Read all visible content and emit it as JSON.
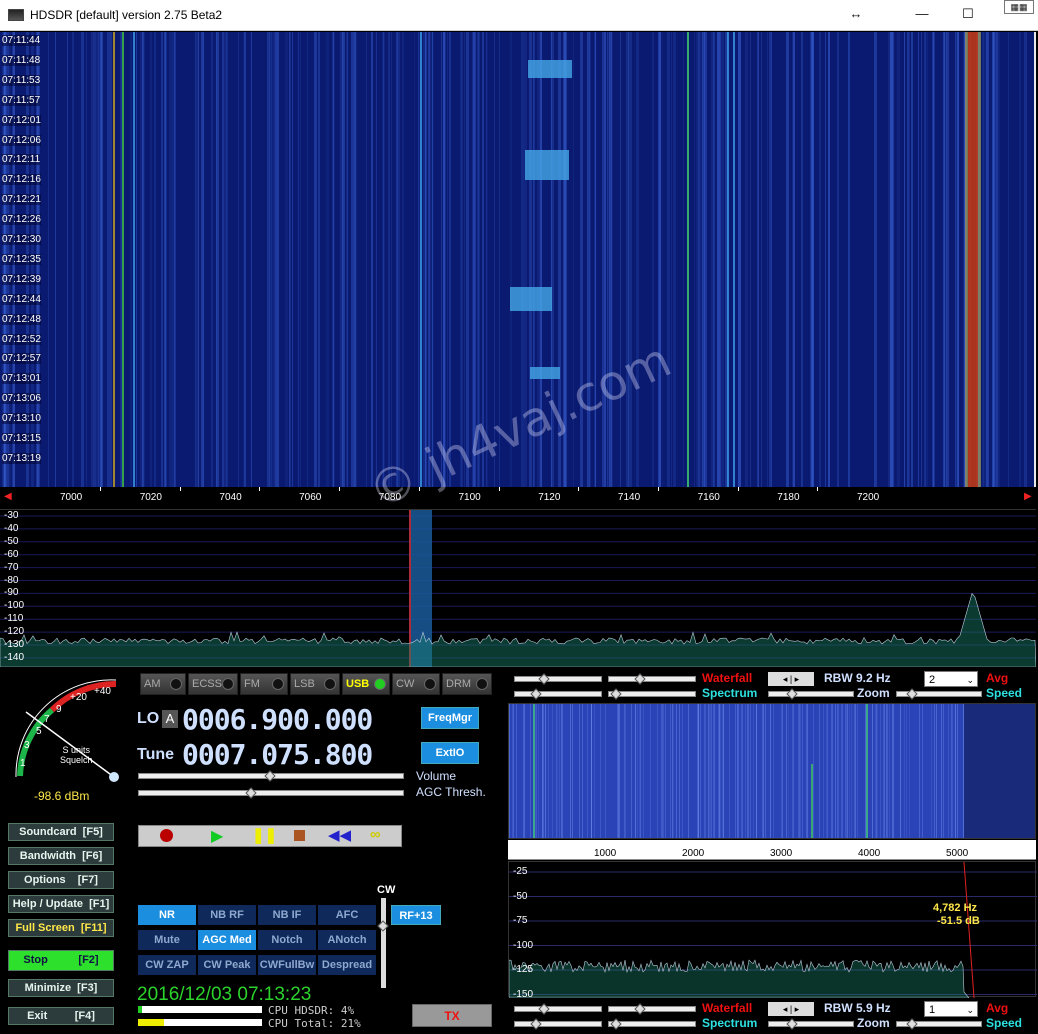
{
  "window": {
    "title": "HDSDR  [default]  version 2.75 Beta2"
  },
  "waterfall": {
    "times": [
      "07:11:44",
      "07:11:48",
      "07:11:53",
      "07:11:57",
      "07:12:01",
      "07:12:06",
      "07:12:11",
      "07:12:16",
      "07:12:21",
      "07:12:26",
      "07:12:30",
      "07:12:35",
      "07:12:39",
      "07:12:44",
      "07:12:48",
      "07:12:52",
      "07:12:57",
      "07:13:01",
      "07:13:06",
      "07:13:10",
      "07:13:15",
      "07:13:19"
    ],
    "freqs": [
      "7000",
      "7020",
      "7040",
      "7060",
      "7080",
      "7100",
      "7120",
      "7140",
      "7160",
      "7180",
      "7200"
    ]
  },
  "spectrum": {
    "db_labels": [
      "-30",
      "-40",
      "-50",
      "-60",
      "-70",
      "-80",
      "-90",
      "-100",
      "-110",
      "-120",
      "-130",
      "-140"
    ]
  },
  "watermark": "© jh4vaj.com",
  "smeter": {
    "scale": [
      "1",
      "3",
      "5",
      "7",
      "9",
      "+20",
      "+40"
    ],
    "squelch": "S units\nSquelch",
    "level": "-98.6 dBm"
  },
  "modes": [
    "AM",
    "ECSS",
    "FM",
    "LSB",
    "USB",
    "CW",
    "DRM"
  ],
  "active_mode": "USB",
  "lo": {
    "label": "LO",
    "badge": "A",
    "value": "0006.900.000"
  },
  "tune": {
    "label": "Tune",
    "value": "0007.075.800"
  },
  "freqmgr": "FreqMgr",
  "extio": "ExtIO",
  "volume": "Volume",
  "agc_thresh": "AGC Thresh.",
  "side_buttons": [
    "Soundcard  [F5]",
    "Bandwidth  [F6]",
    "Options    [F7]",
    "Help / Update  [F1]",
    "Full Screen  [F11]",
    "Stop          [F2]",
    "Minimize  [F3]",
    "Exit         [F4]"
  ],
  "dsp_row1": [
    "NR",
    "NB RF",
    "NB IF",
    "AFC"
  ],
  "dsp_row2": [
    "Mute",
    "AGC Med",
    "Notch",
    "ANotch"
  ],
  "dsp_row3": [
    "CW ZAP",
    "CW Peak",
    "CWFullBw",
    "Despread"
  ],
  "rf": "RF+13",
  "cw_label": "CW",
  "datetime": "2016/12/03 07:13:23",
  "cpu": {
    "hdsdr": "CPU HDSDR:  4%",
    "total": "CPU Total: 21%"
  },
  "tx": "TX",
  "panel_top": {
    "waterfall": "Waterfall",
    "spectrum": "Spectrum",
    "rbw": "RBW  9.2 Hz",
    "zoom": "Zoom",
    "avg_val": "2",
    "avg": "Avg",
    "speed": "Speed"
  },
  "panel_bottom": {
    "waterfall": "Waterfall",
    "spectrum": "Spectrum",
    "rbw": "RBW  5.9 Hz",
    "zoom": "Zoom",
    "avg_val": "1",
    "avg": "Avg",
    "speed": "Speed"
  },
  "audio": {
    "freqs": [
      "1000",
      "2000",
      "3000",
      "4000",
      "5000"
    ],
    "db": [
      "-25",
      "-50",
      "-75",
      "-100",
      "-125",
      "-150"
    ],
    "cursor_hz": "4,782 Hz",
    "cursor_db": "-51.5 dB"
  }
}
